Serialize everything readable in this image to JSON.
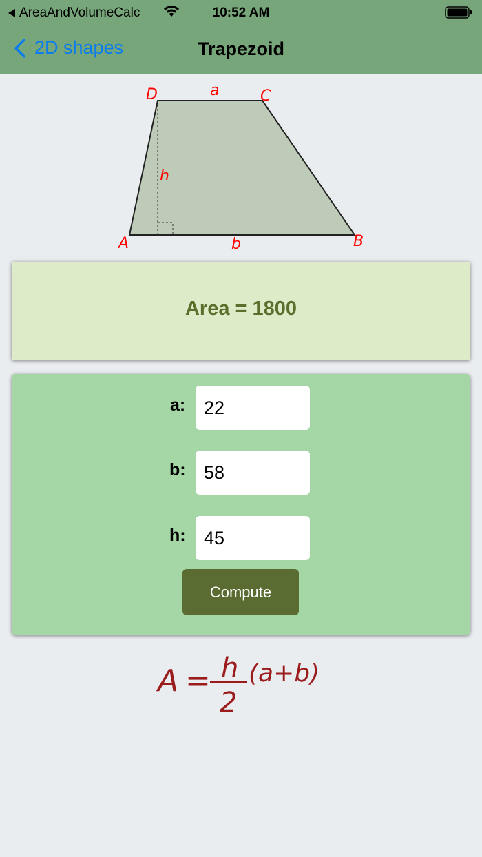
{
  "status_bar": {
    "back_app": "AreaAndVolumeCalc",
    "time": "10:52 AM"
  },
  "nav": {
    "back_label": "2D shapes",
    "title": "Trapezoid"
  },
  "diagram": {
    "labels": {
      "D": "D",
      "a": "a",
      "C": "C",
      "h": "h",
      "A": "A",
      "b": "b",
      "B": "B"
    },
    "fill_color": "#bfcbb9",
    "label_color": "#ff0000"
  },
  "result": {
    "text": "Area = 1800"
  },
  "inputs": {
    "a": {
      "label": "a:",
      "value": "22"
    },
    "b": {
      "label": "b:",
      "value": "58"
    },
    "h": {
      "label": "h:",
      "value": "45"
    }
  },
  "compute_label": "Compute",
  "formula": {
    "A": "A",
    "eq": "=",
    "num": "h",
    "den": "2",
    "rest": "(a+b)"
  },
  "colors": {
    "header": "#76a679",
    "background": "#eaedf0",
    "result_card": "#ddebc9",
    "input_card": "#a5d6a6",
    "button": "#5a6c31",
    "link": "#0a7cf0",
    "formula": "#9b1c1c"
  }
}
